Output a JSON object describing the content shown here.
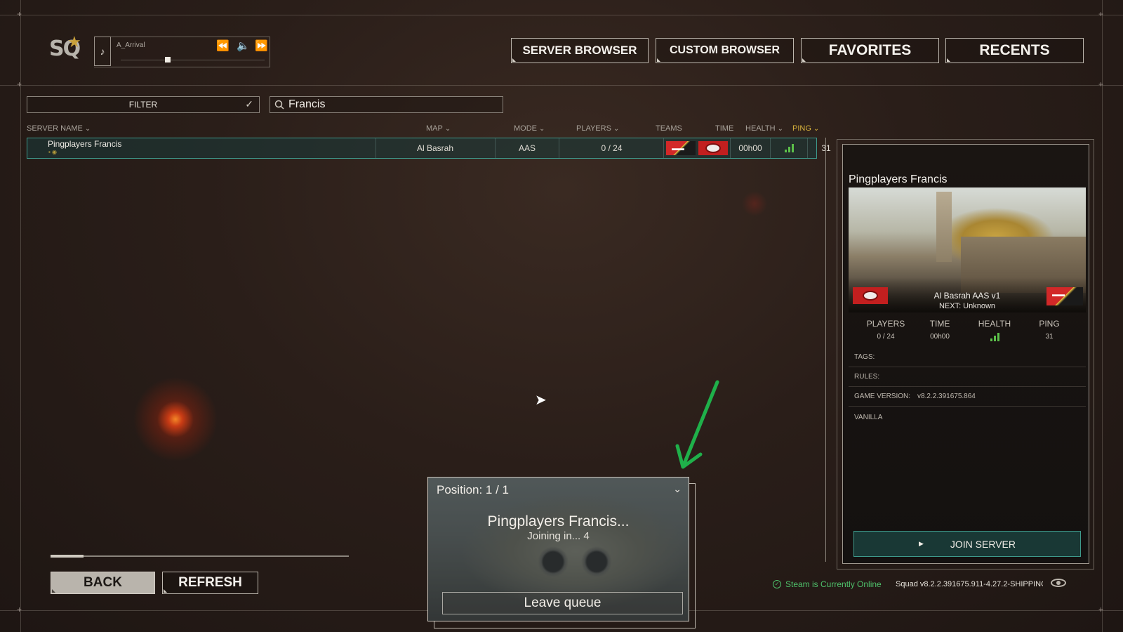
{
  "header": {
    "logo_text": "SQ",
    "music": {
      "track": "A_Arrival",
      "progress": 0.33
    },
    "nav": [
      "SERVER BROWSER",
      "CUSTOM BROWSER",
      "FAVORITES",
      "RECENTS"
    ]
  },
  "filter": {
    "label": "FILTER",
    "search_value": "Francis"
  },
  "columns": {
    "server_name": "SERVER NAME",
    "map": "MAP",
    "mode": "MODE",
    "players": "PLAYERS",
    "teams": "TEAMS",
    "time": "TIME",
    "health": "HEALTH",
    "ping": "PING"
  },
  "server_row": {
    "name": "Pingplayers Francis",
    "map": "Al Basrah",
    "mode": "AAS",
    "players": "0 / 24",
    "time": "00h00",
    "ping": "31"
  },
  "details": {
    "title": "Pingplayers Francis",
    "map_name": "Al Basrah AAS v1",
    "next": "NEXT: Unknown",
    "stats": {
      "players_label": "PLAYERS",
      "players": "0 / 24",
      "time_label": "TIME",
      "time": "00h00",
      "health_label": "HEALTH",
      "ping_label": "PING",
      "ping": "31"
    },
    "tags": "TAGS:",
    "rules": "RULES:",
    "game_version_label": "GAME VERSION:",
    "game_version": "v8.2.2.391675.864",
    "vanilla": "VANILLA",
    "join_label": "JOIN SERVER"
  },
  "status": {
    "steam": "Steam is Currently Online",
    "version": "Squad v8.2.2.391675.911-4.27.2-SHIPPING"
  },
  "bottom": {
    "back": "BACK",
    "refresh": "REFRESH",
    "refresh_progress": 0.11
  },
  "queue": {
    "position": "Position: 1 / 1",
    "server": "Pingplayers Francis...",
    "joining": "Joining in... 4",
    "leave": "Leave queue"
  },
  "colors": {
    "accent_teal": "#3e9a8c",
    "ping_highlight": "#d9b43c",
    "steam_green": "#4ec06a",
    "annotation_arrow": "#1fb04a"
  }
}
